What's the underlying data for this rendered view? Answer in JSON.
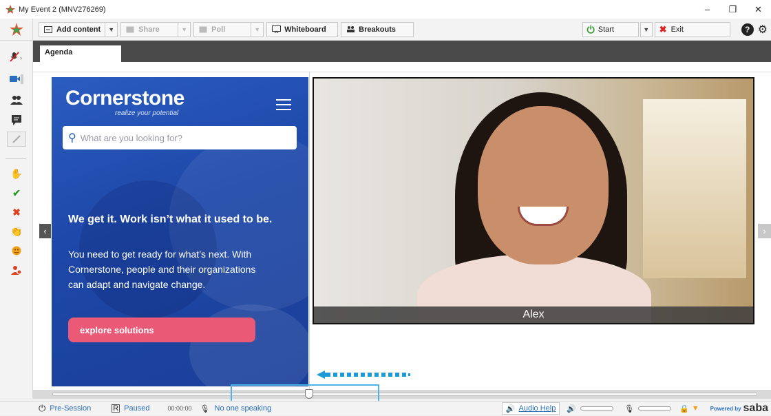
{
  "window": {
    "title": "My Event 2 (MNV276269)",
    "controls": [
      "–",
      "❐",
      "✕"
    ]
  },
  "toolbar": {
    "add_content": "Add content",
    "share": "Share",
    "poll": "Poll",
    "whiteboard": "Whiteboard",
    "breakouts": "Breakouts",
    "start": "Start",
    "exit": "Exit"
  },
  "tabs": [
    {
      "label": "Agenda"
    }
  ],
  "web_panel": {
    "brand": "Cornerstone",
    "tagline": "realize your potential",
    "search_placeholder": "What are you looking for?",
    "headline": "We get it. Work isn’t what it used to be.",
    "body": "You need to get ready for what’s next. With Cornerstone, people and their organizations can adapt and navigate change.",
    "cta": "explore solutions"
  },
  "video": {
    "participant_name": "Alex"
  },
  "statusbar": {
    "session_state": "Pre-Session",
    "recording": "Paused",
    "timer": "00:00:00",
    "speaking": "No one speaking",
    "audio_help": "Audio Help",
    "powered_by": "Powered by",
    "brand": "saba"
  },
  "colors": {
    "accent_blue": "#2a6ebb",
    "start_green": "#2e9a2e",
    "exit_red": "#d22222",
    "cta_pink": "#ea5a76",
    "highlight": "#4fb3e8"
  },
  "icons": {
    "left_bar": [
      "mic-muted-icon",
      "camera-icon",
      "attendees-icon",
      "chat-icon",
      "pen-icon",
      "raise-hand-icon",
      "check-icon",
      "x-icon",
      "applause-icon",
      "emoji-icon",
      "user-away-icon"
    ]
  }
}
